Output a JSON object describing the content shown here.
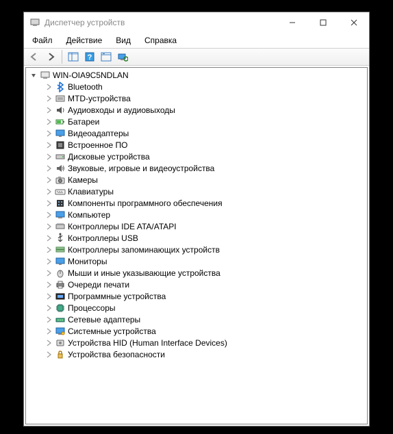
{
  "window": {
    "title": "Диспетчер устройств"
  },
  "menu": {
    "file": "Файл",
    "action": "Действие",
    "view": "Вид",
    "help": "Справка"
  },
  "tree": {
    "root": "WIN-OIA9C5NDLAN",
    "items": [
      {
        "label": "Bluetooth",
        "icon": "bluetooth"
      },
      {
        "label": "MTD-устройства",
        "icon": "mtd"
      },
      {
        "label": "Аудиовходы и аудиовыходы",
        "icon": "audio"
      },
      {
        "label": "Батареи",
        "icon": "battery"
      },
      {
        "label": "Видеоадаптеры",
        "icon": "display"
      },
      {
        "label": "Встроенное ПО",
        "icon": "firmware"
      },
      {
        "label": "Дисковые устройства",
        "icon": "disk"
      },
      {
        "label": "Звуковые, игровые и видеоустройства",
        "icon": "sound"
      },
      {
        "label": "Камеры",
        "icon": "camera"
      },
      {
        "label": "Клавиатуры",
        "icon": "keyboard"
      },
      {
        "label": "Компоненты программного обеспечения",
        "icon": "software"
      },
      {
        "label": "Компьютер",
        "icon": "computer"
      },
      {
        "label": "Контроллеры IDE ATA/ATAPI",
        "icon": "ide"
      },
      {
        "label": "Контроллеры USB",
        "icon": "usb"
      },
      {
        "label": "Контроллеры запоминающих устройств",
        "icon": "storage"
      },
      {
        "label": "Мониторы",
        "icon": "monitor"
      },
      {
        "label": "Мыши и иные указывающие устройства",
        "icon": "mouse"
      },
      {
        "label": "Очереди печати",
        "icon": "print"
      },
      {
        "label": "Программные устройства",
        "icon": "softdev"
      },
      {
        "label": "Процессоры",
        "icon": "cpu"
      },
      {
        "label": "Сетевые адаптеры",
        "icon": "network"
      },
      {
        "label": "Системные устройства",
        "icon": "system"
      },
      {
        "label": "Устройства HID (Human Interface Devices)",
        "icon": "hid"
      },
      {
        "label": "Устройства безопасности",
        "icon": "security"
      }
    ]
  }
}
